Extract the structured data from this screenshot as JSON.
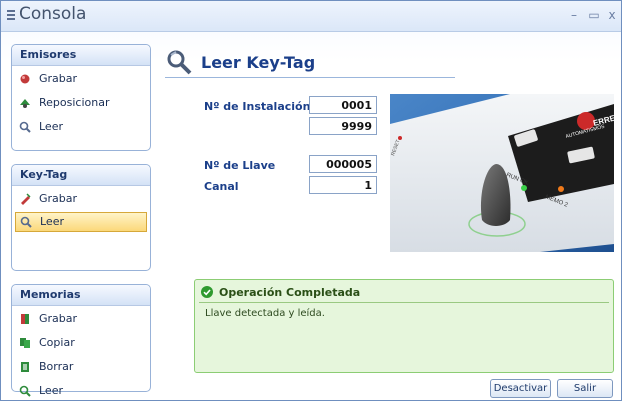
{
  "window": {
    "title": "Consola",
    "minimize": "–",
    "maximize": "▭",
    "close": "x"
  },
  "sidebar": {
    "emisores": {
      "title": "Emisores",
      "items": [
        {
          "label": "Grabar",
          "icon": "record-icon"
        },
        {
          "label": "Reposicionar",
          "icon": "reposition-icon"
        },
        {
          "label": "Leer",
          "icon": "read-icon"
        }
      ]
    },
    "keytag": {
      "title": "Key-Tag",
      "items": [
        {
          "label": "Grabar",
          "icon": "record-icon"
        },
        {
          "label": "Leer",
          "icon": "read-icon",
          "active": true
        }
      ]
    },
    "memorias": {
      "title": "Memorias",
      "items": [
        {
          "label": "Grabar",
          "icon": "record-icon"
        },
        {
          "label": "Copiar",
          "icon": "copy-icon"
        },
        {
          "label": "Borrar",
          "icon": "delete-icon"
        },
        {
          "label": "Leer",
          "icon": "read-icon"
        }
      ]
    }
  },
  "main": {
    "title": "Leer Key-Tag",
    "installation_label": "Nº de Instalación",
    "installation_value_1": "0001",
    "installation_value_2": "9999",
    "key_label": "Nº de Llave",
    "key_value": "000005",
    "channel_label": "Canal",
    "channel_value": "1"
  },
  "device": {
    "brand": "ERREKA",
    "brand_sub": "AUTOMATISMOS",
    "run_ok": "RUN OK",
    "memo": "MEMO 2",
    "reset": "RESET"
  },
  "status": {
    "title": "Operación Completada",
    "message": "Llave detectada y leída."
  },
  "buttons": {
    "deactivate": "Desactivar",
    "exit": "Salir"
  },
  "colors": {
    "accent": "#1b3f8a",
    "success_bg": "#e6f6dc",
    "success_border": "#8ccd74",
    "active_item": "#fbd87a"
  }
}
